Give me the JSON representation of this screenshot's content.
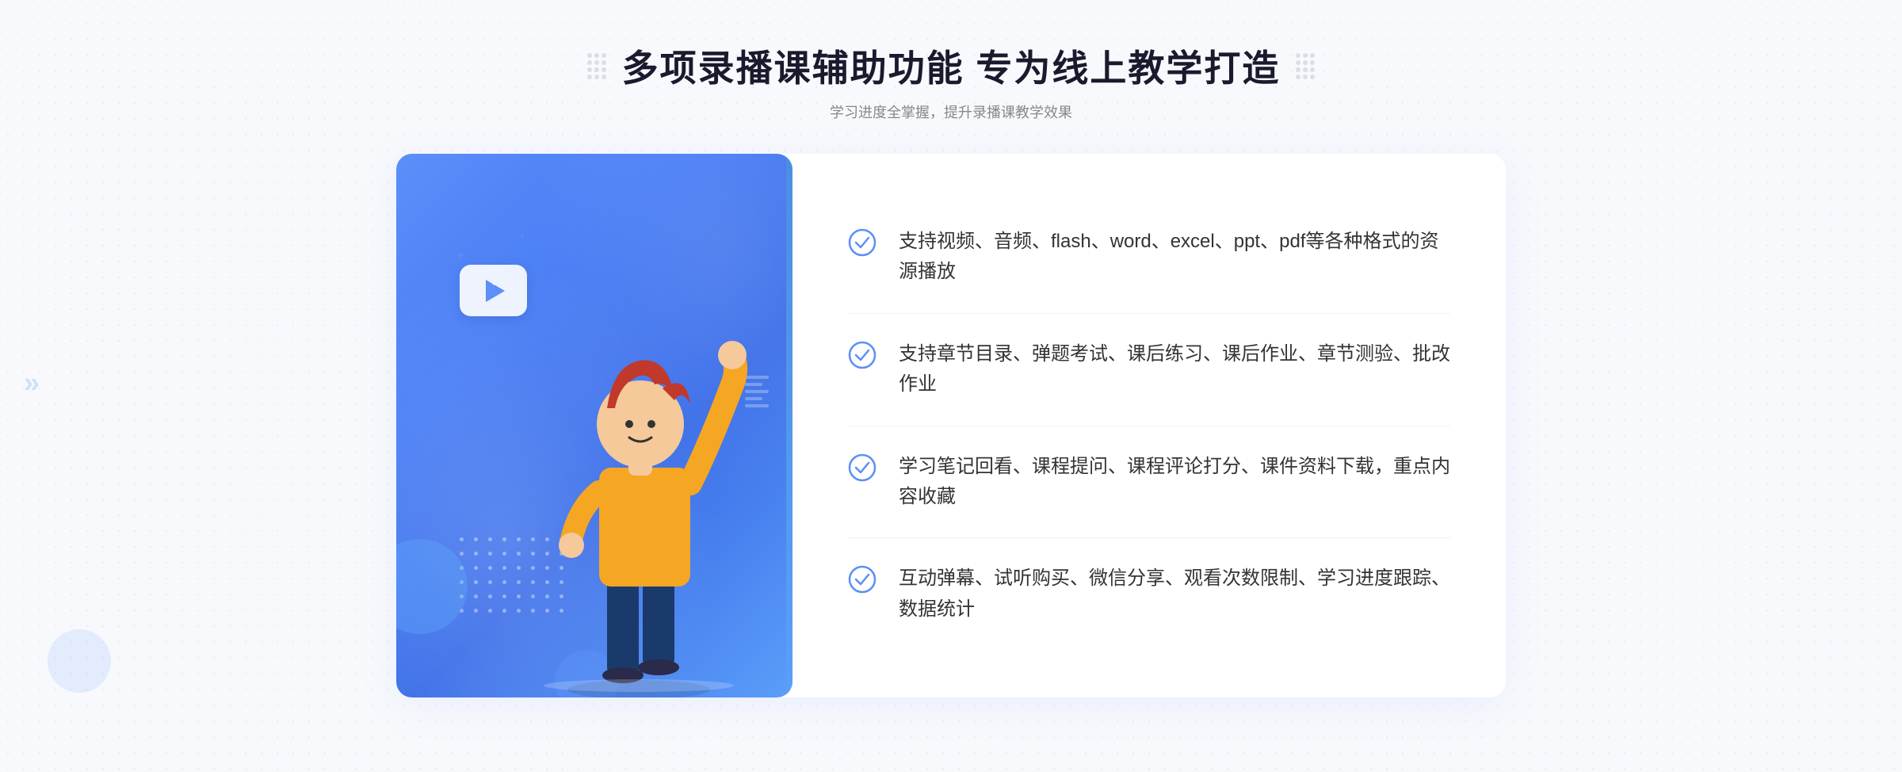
{
  "page": {
    "background_color": "#f8f9fc"
  },
  "header": {
    "main_title": "多项录播课辅助功能 专为线上教学打造",
    "sub_title": "学习进度全掌握，提升录播课教学效果"
  },
  "features": [
    {
      "id": "feature-1",
      "text": "支持视频、音频、flash、word、excel、ppt、pdf等各种格式的资源播放"
    },
    {
      "id": "feature-2",
      "text": "支持章节目录、弹题考试、课后练习、课后作业、章节测验、批改作业"
    },
    {
      "id": "feature-3",
      "text": "学习笔记回看、课程提问、课程评论打分、课件资料下载，重点内容收藏"
    },
    {
      "id": "feature-4",
      "text": "互动弹幕、试听购买、微信分享、观看次数限制、学习进度跟踪、数据统计"
    }
  ],
  "icons": {
    "check": "✓",
    "play": "▶",
    "chevron_left": "«",
    "dot": "·"
  },
  "colors": {
    "primary_blue": "#5b8ff9",
    "text_dark": "#1a1a2e",
    "text_gray": "#888888",
    "text_body": "#333333",
    "border_light": "#f0f2f8"
  }
}
